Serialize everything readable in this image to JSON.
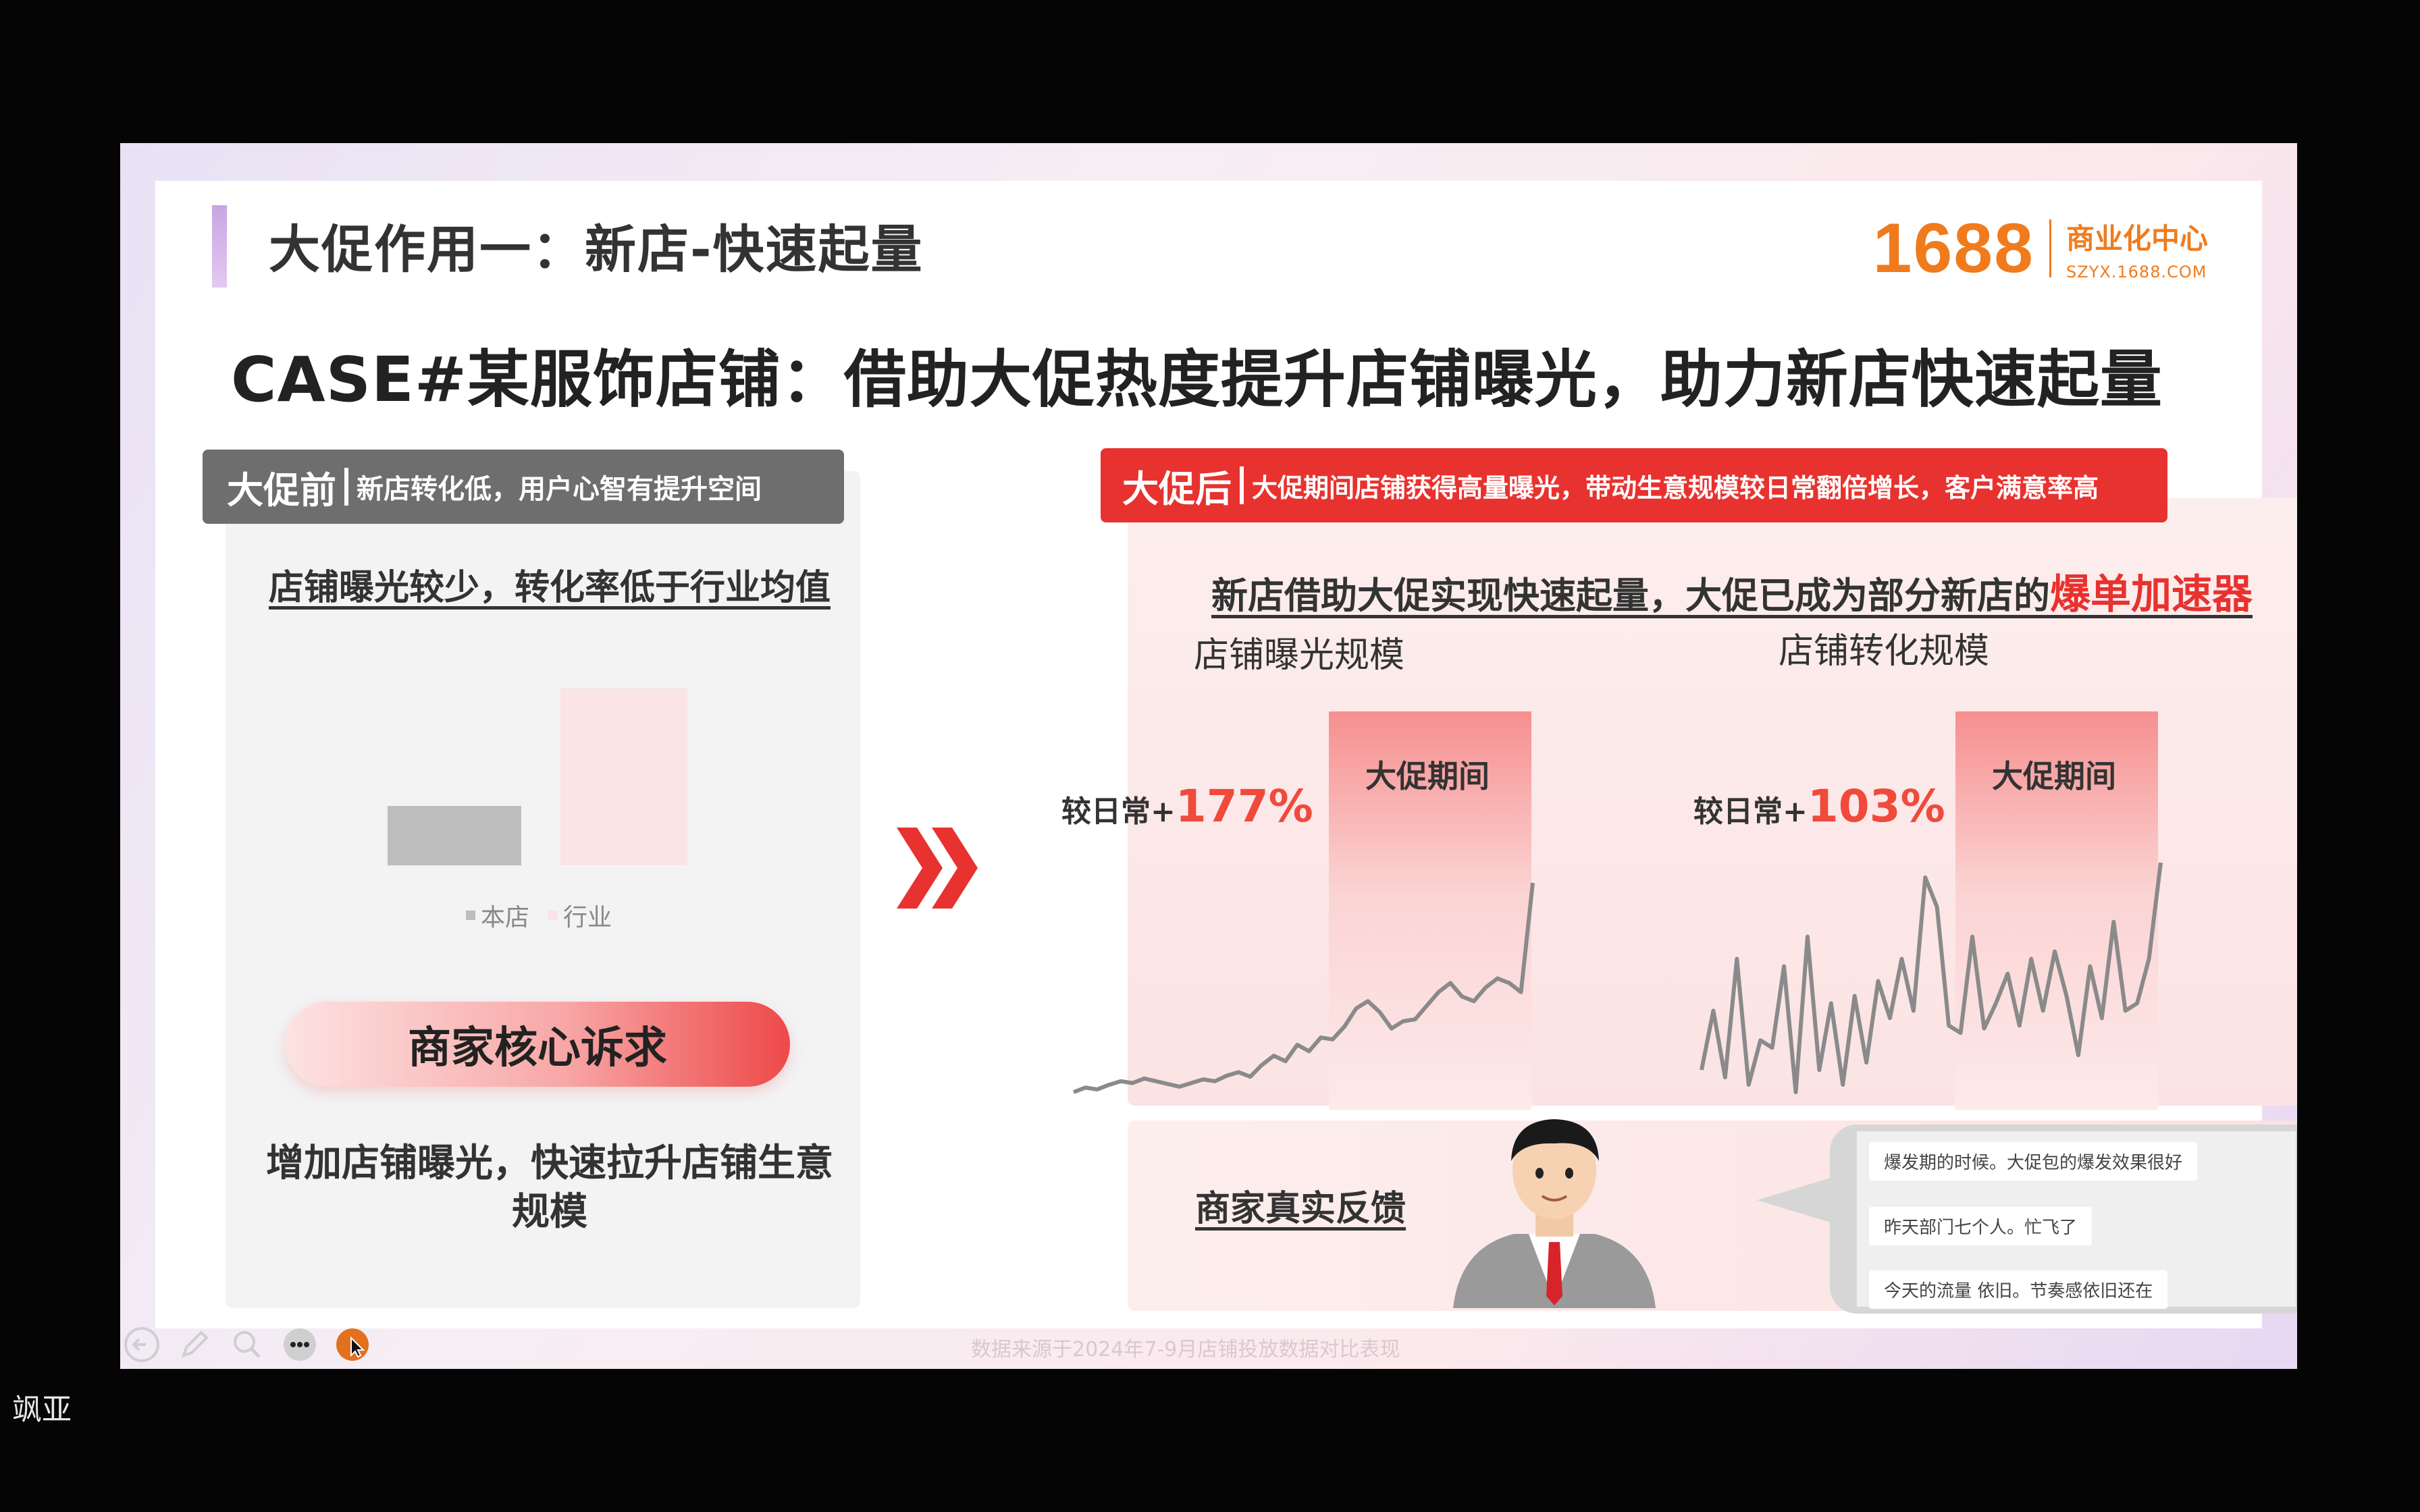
{
  "slide": {
    "title": "大促作用一：新店-快速起量",
    "logo_number": "1688",
    "logo_name": "商业化中心",
    "logo_url_text": "SZYX.1688.COM",
    "headline": "CASE#某服饰店铺：借助大促热度提升店铺曝光，助力新店快速起量",
    "footnote": "数据来源于2024年7-9月店铺投放数据对比表现"
  },
  "left": {
    "tag_main": "大促前",
    "tag_sub": "新店转化低，用户心智有提升空间",
    "subtitle": "店铺曝光较少，转化率低于行业均值",
    "legend": [
      "本店",
      "行业"
    ],
    "pill": "商家核心诉求",
    "body": "增加店铺曝光，快速拉升店铺生意规模"
  },
  "right": {
    "tag_main": "大促后",
    "tag_sub": "大促期间店铺获得高量曝光，带动生意规模较日常翻倍增长，客户满意率高",
    "subtitle_prefix": "新店借助大促实现快速起量，大促已成为部分新店的",
    "subtitle_highlight": "爆单加速器",
    "chart1": {
      "title": "店铺曝光规模",
      "compare_label": "较日常+",
      "pct": "177%",
      "promo_label": "大促期间"
    },
    "chart2": {
      "title": "店铺转化规模",
      "compare_label": "较日常+",
      "pct": "103%",
      "promo_label": "大促期间"
    },
    "feedback_title": "商家真实反馈",
    "messages": [
      "爆发期的时候。大促包的爆发效果很好",
      "昨天部门七个人。忙飞了",
      "今天的流量 依旧。节奏感依旧还在"
    ]
  },
  "presenter": "飒亚",
  "colors": {
    "accent_red": "#e8322f",
    "brand_orange": "#f07b1d",
    "gray_tag": "#6e6e6e"
  },
  "chart_data": [
    {
      "type": "bar",
      "categories": [
        "本店",
        "行业"
      ],
      "values": [
        1,
        3
      ],
      "title": "",
      "xlabel": "",
      "ylabel": ""
    },
    {
      "type": "line",
      "title": "店铺曝光规模",
      "x": [
        0,
        1,
        2,
        3,
        4,
        5,
        6,
        7,
        8,
        9,
        10,
        11,
        12,
        13,
        14,
        15,
        16,
        17,
        18,
        19,
        20,
        21,
        22,
        23,
        24,
        25,
        26,
        27,
        28,
        29,
        30,
        31,
        32,
        33,
        34,
        35,
        36,
        37,
        38,
        39
      ],
      "series": [
        {
          "values": [
            0,
            5,
            3,
            8,
            12,
            10,
            15,
            12,
            9,
            6,
            10,
            14,
            12,
            18,
            22,
            17,
            30,
            40,
            34,
            52,
            45,
            60,
            58,
            72,
            92,
            100,
            88,
            70,
            78,
            80,
            95,
            110,
            120,
            105,
            100,
            115,
            125,
            120,
            110,
            230
          ]
        }
      ],
      "annotation": "大促期间"
    },
    {
      "type": "line",
      "title": "店铺转化规模",
      "x": [
        0,
        1,
        2,
        3,
        4,
        5,
        6,
        7,
        8,
        9,
        10,
        11,
        12,
        13,
        14,
        15,
        16,
        17,
        18,
        19,
        20,
        21,
        22,
        23,
        24,
        25,
        26,
        27,
        28,
        29,
        30,
        31,
        32,
        33,
        34,
        35,
        36,
        37,
        38,
        39
      ],
      "series": [
        {
          "values": [
            20,
            60,
            15,
            95,
            10,
            40,
            35,
            90,
            5,
            110,
            20,
            65,
            10,
            70,
            25,
            80,
            55,
            95,
            60,
            150,
            130,
            50,
            45,
            110,
            48,
            65,
            85,
            50,
            95,
            60,
            100,
            70,
            30,
            90,
            55,
            120,
            60,
            65,
            95,
            160
          ]
        }
      ],
      "annotation": "大促期间"
    }
  ]
}
